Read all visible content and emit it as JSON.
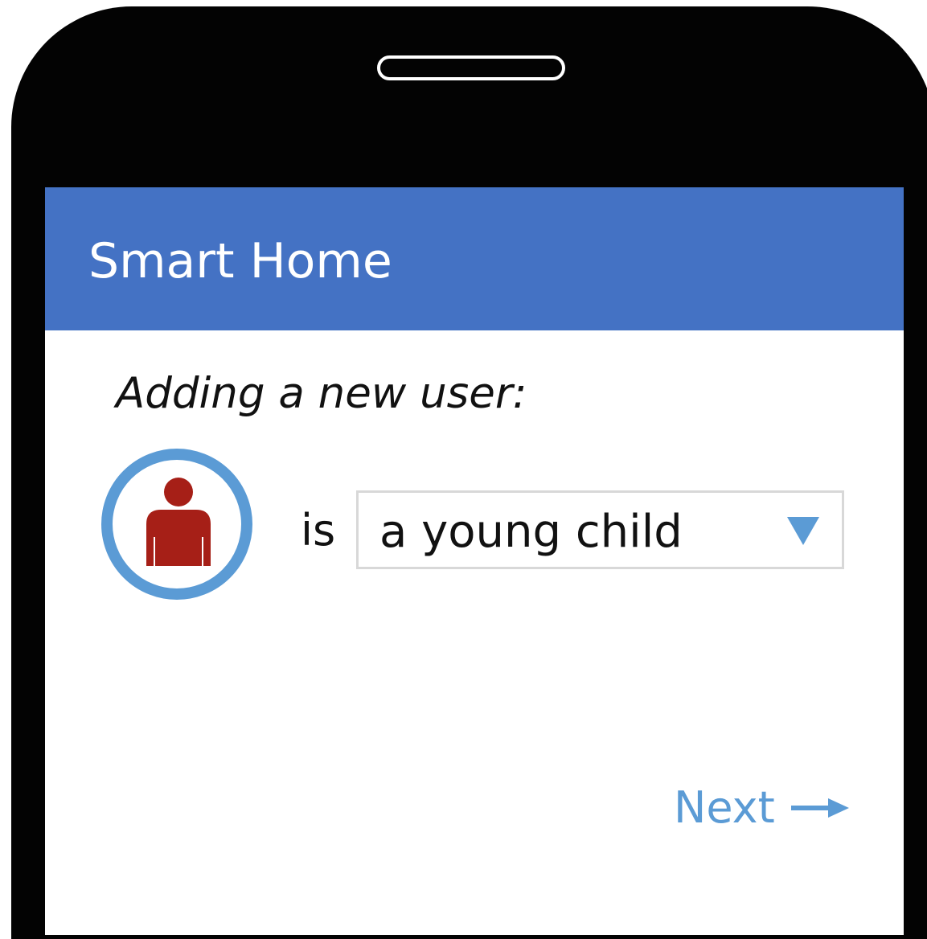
{
  "app": {
    "title": "Smart Home"
  },
  "form": {
    "prompt": "Adding a new user:",
    "connector": "is",
    "role_select": {
      "selected": "a young child"
    },
    "avatar_icon": "person-icon"
  },
  "actions": {
    "next_label": "Next",
    "next_icon": "arrow-right-icon"
  },
  "colors": {
    "app_bar": "#4472c4",
    "accent": "#5b9bd5",
    "avatar_figure": "#a61f17",
    "phone_body": "#030303"
  }
}
